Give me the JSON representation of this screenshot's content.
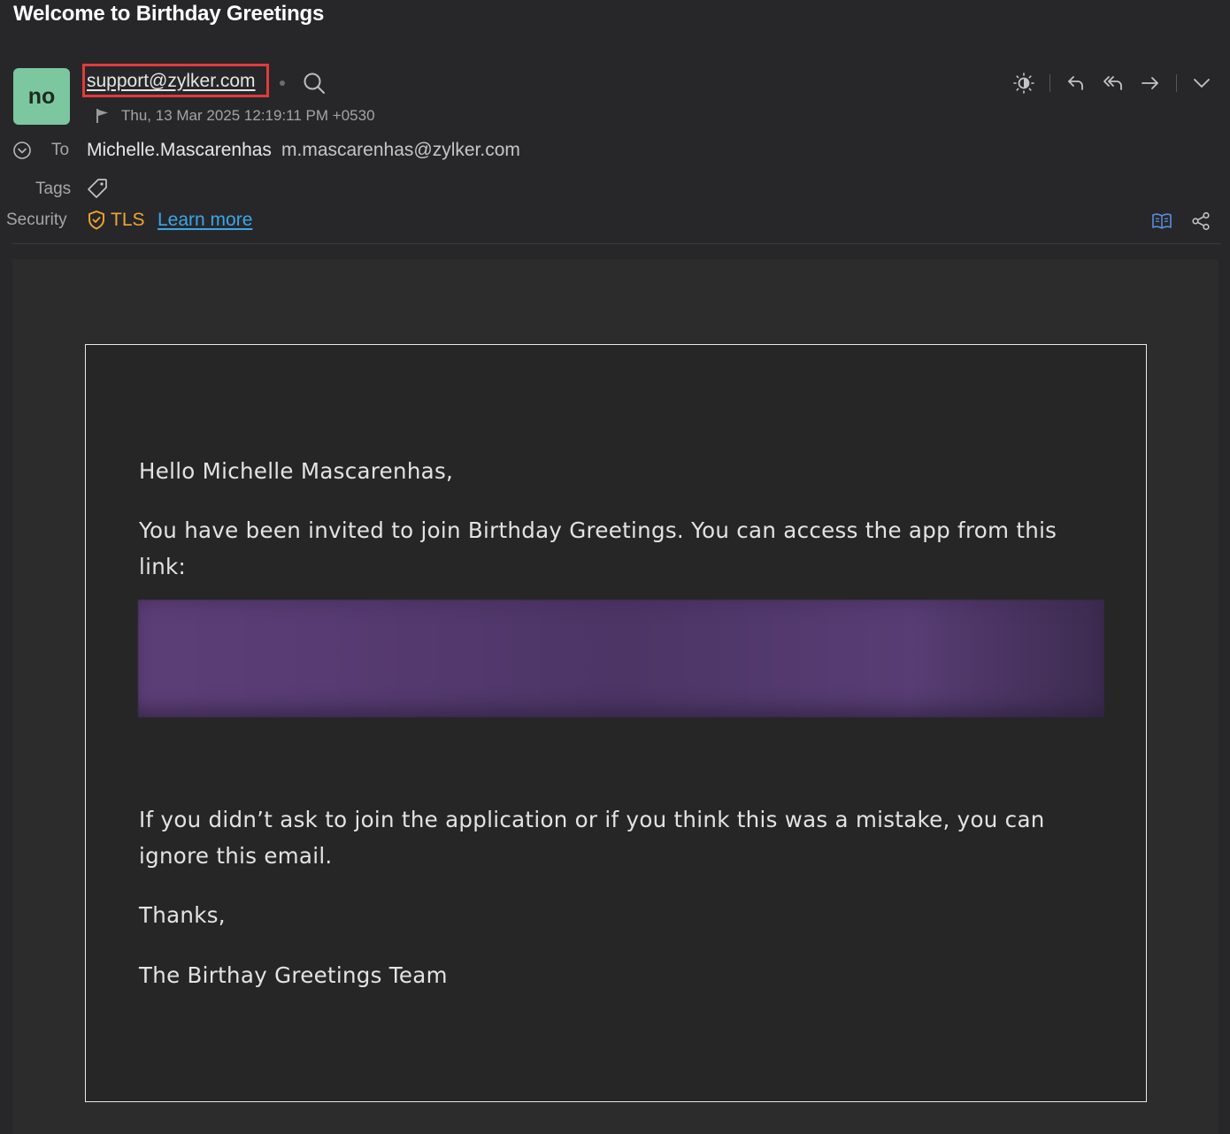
{
  "email": {
    "subject": "Welcome to Birthday Greetings",
    "avatar_initials": "no",
    "sender": "support@zylker.com",
    "date": "Thu, 13 Mar 2025 12:19:11 PM +0530",
    "to_label": "To",
    "to_name": "Michelle.Mascarenhas",
    "to_email": "m.mascarenhas@zylker.com",
    "tags_label": "Tags",
    "security_label": "Security",
    "security_value": "TLS",
    "learn_more": "Learn more"
  },
  "toolbar": {
    "icons": [
      "theme-toggle-icon",
      "reply-icon",
      "reply-all-icon",
      "forward-icon",
      "more-dropdown-icon"
    ]
  },
  "body": {
    "greeting": "Hello Michelle Mascarenhas,",
    "paragraph1": "You have been invited to join Birthday Greetings. You can access the app from this link:",
    "paragraph2": "If you didn’t ask to join the application or if you think this was a mistake, you can ignore this email.",
    "closing": "Thanks,",
    "signature": "The Birthay Greetings Team"
  },
  "colors": {
    "background": "#27272a",
    "avatar": "#7cc7a0",
    "tls": "#f0a533",
    "link": "#3ba6e8",
    "highlight_box": "#e23b3b"
  }
}
